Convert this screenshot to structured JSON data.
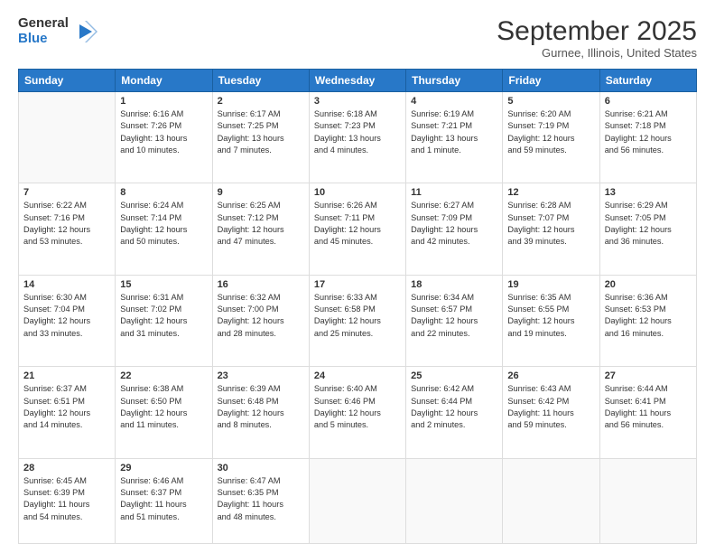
{
  "logo": {
    "general": "General",
    "blue": "Blue"
  },
  "title": "September 2025",
  "subtitle": "Gurnee, Illinois, United States",
  "days_of_week": [
    "Sunday",
    "Monday",
    "Tuesday",
    "Wednesday",
    "Thursday",
    "Friday",
    "Saturday"
  ],
  "weeks": [
    [
      {
        "day": "",
        "info": ""
      },
      {
        "day": "1",
        "info": "Sunrise: 6:16 AM\nSunset: 7:26 PM\nDaylight: 13 hours\nand 10 minutes."
      },
      {
        "day": "2",
        "info": "Sunrise: 6:17 AM\nSunset: 7:25 PM\nDaylight: 13 hours\nand 7 minutes."
      },
      {
        "day": "3",
        "info": "Sunrise: 6:18 AM\nSunset: 7:23 PM\nDaylight: 13 hours\nand 4 minutes."
      },
      {
        "day": "4",
        "info": "Sunrise: 6:19 AM\nSunset: 7:21 PM\nDaylight: 13 hours\nand 1 minute."
      },
      {
        "day": "5",
        "info": "Sunrise: 6:20 AM\nSunset: 7:19 PM\nDaylight: 12 hours\nand 59 minutes."
      },
      {
        "day": "6",
        "info": "Sunrise: 6:21 AM\nSunset: 7:18 PM\nDaylight: 12 hours\nand 56 minutes."
      }
    ],
    [
      {
        "day": "7",
        "info": "Sunrise: 6:22 AM\nSunset: 7:16 PM\nDaylight: 12 hours\nand 53 minutes."
      },
      {
        "day": "8",
        "info": "Sunrise: 6:24 AM\nSunset: 7:14 PM\nDaylight: 12 hours\nand 50 minutes."
      },
      {
        "day": "9",
        "info": "Sunrise: 6:25 AM\nSunset: 7:12 PM\nDaylight: 12 hours\nand 47 minutes."
      },
      {
        "day": "10",
        "info": "Sunrise: 6:26 AM\nSunset: 7:11 PM\nDaylight: 12 hours\nand 45 minutes."
      },
      {
        "day": "11",
        "info": "Sunrise: 6:27 AM\nSunset: 7:09 PM\nDaylight: 12 hours\nand 42 minutes."
      },
      {
        "day": "12",
        "info": "Sunrise: 6:28 AM\nSunset: 7:07 PM\nDaylight: 12 hours\nand 39 minutes."
      },
      {
        "day": "13",
        "info": "Sunrise: 6:29 AM\nSunset: 7:05 PM\nDaylight: 12 hours\nand 36 minutes."
      }
    ],
    [
      {
        "day": "14",
        "info": "Sunrise: 6:30 AM\nSunset: 7:04 PM\nDaylight: 12 hours\nand 33 minutes."
      },
      {
        "day": "15",
        "info": "Sunrise: 6:31 AM\nSunset: 7:02 PM\nDaylight: 12 hours\nand 31 minutes."
      },
      {
        "day": "16",
        "info": "Sunrise: 6:32 AM\nSunset: 7:00 PM\nDaylight: 12 hours\nand 28 minutes."
      },
      {
        "day": "17",
        "info": "Sunrise: 6:33 AM\nSunset: 6:58 PM\nDaylight: 12 hours\nand 25 minutes."
      },
      {
        "day": "18",
        "info": "Sunrise: 6:34 AM\nSunset: 6:57 PM\nDaylight: 12 hours\nand 22 minutes."
      },
      {
        "day": "19",
        "info": "Sunrise: 6:35 AM\nSunset: 6:55 PM\nDaylight: 12 hours\nand 19 minutes."
      },
      {
        "day": "20",
        "info": "Sunrise: 6:36 AM\nSunset: 6:53 PM\nDaylight: 12 hours\nand 16 minutes."
      }
    ],
    [
      {
        "day": "21",
        "info": "Sunrise: 6:37 AM\nSunset: 6:51 PM\nDaylight: 12 hours\nand 14 minutes."
      },
      {
        "day": "22",
        "info": "Sunrise: 6:38 AM\nSunset: 6:50 PM\nDaylight: 12 hours\nand 11 minutes."
      },
      {
        "day": "23",
        "info": "Sunrise: 6:39 AM\nSunset: 6:48 PM\nDaylight: 12 hours\nand 8 minutes."
      },
      {
        "day": "24",
        "info": "Sunrise: 6:40 AM\nSunset: 6:46 PM\nDaylight: 12 hours\nand 5 minutes."
      },
      {
        "day": "25",
        "info": "Sunrise: 6:42 AM\nSunset: 6:44 PM\nDaylight: 12 hours\nand 2 minutes."
      },
      {
        "day": "26",
        "info": "Sunrise: 6:43 AM\nSunset: 6:42 PM\nDaylight: 11 hours\nand 59 minutes."
      },
      {
        "day": "27",
        "info": "Sunrise: 6:44 AM\nSunset: 6:41 PM\nDaylight: 11 hours\nand 56 minutes."
      }
    ],
    [
      {
        "day": "28",
        "info": "Sunrise: 6:45 AM\nSunset: 6:39 PM\nDaylight: 11 hours\nand 54 minutes."
      },
      {
        "day": "29",
        "info": "Sunrise: 6:46 AM\nSunset: 6:37 PM\nDaylight: 11 hours\nand 51 minutes."
      },
      {
        "day": "30",
        "info": "Sunrise: 6:47 AM\nSunset: 6:35 PM\nDaylight: 11 hours\nand 48 minutes."
      },
      {
        "day": "",
        "info": ""
      },
      {
        "day": "",
        "info": ""
      },
      {
        "day": "",
        "info": ""
      },
      {
        "day": "",
        "info": ""
      }
    ]
  ]
}
